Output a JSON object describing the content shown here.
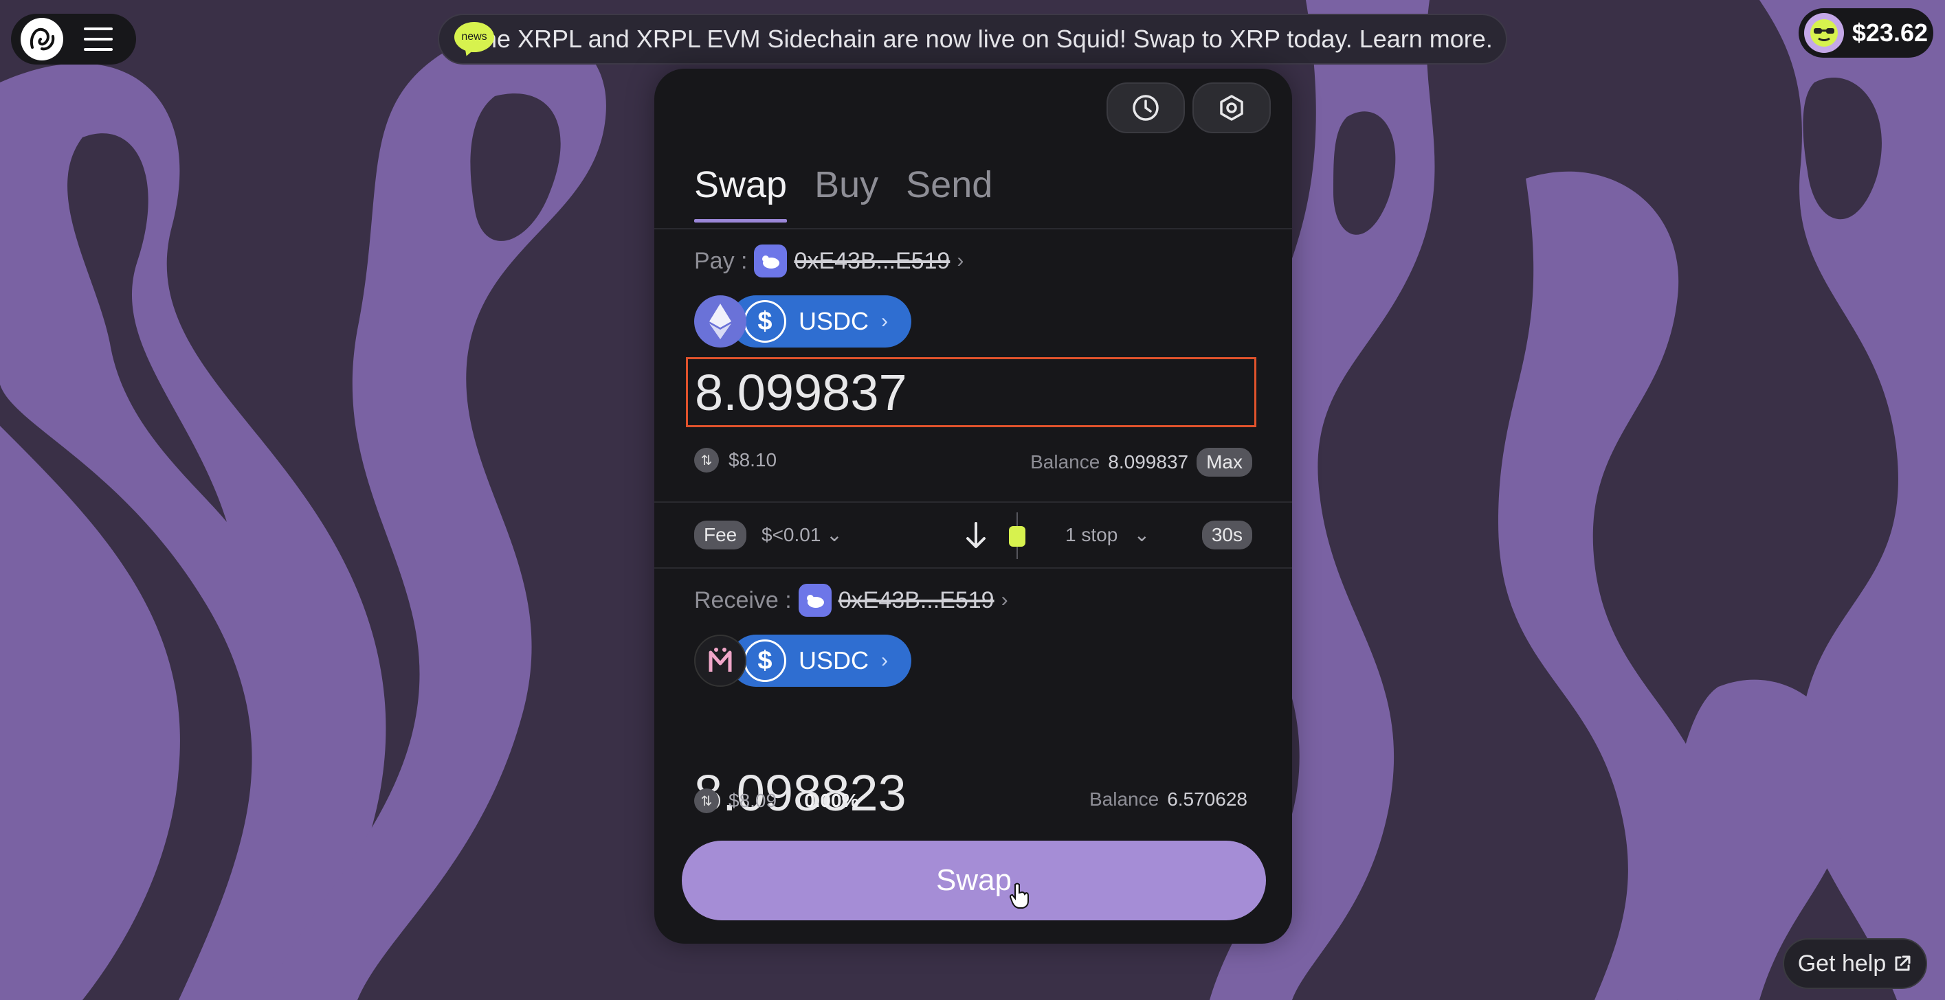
{
  "banner": {
    "badge": "news",
    "text": "The XRPL and XRPL EVM Sidechain are now live on Squid! Swap to XRP today. Learn more.",
    "link_icon": "external-link-icon"
  },
  "wallet": {
    "balance": "$23.62",
    "avatar_icon": "sunglasses-face-icon"
  },
  "tabs": [
    "Swap",
    "Buy",
    "Send"
  ],
  "active_tab": "Swap",
  "pay": {
    "label": "Pay :",
    "address": "0xE43B...E519",
    "chain_icon": "ethereum-icon",
    "token": "USDC",
    "amount": "8.099837",
    "usd_value": "$8.10",
    "balance_label": "Balance",
    "balance": "8.099837",
    "max_label": "Max"
  },
  "route": {
    "fee_label": "Fee",
    "fee_value": "$<0.01",
    "stops": "1 stop",
    "time": "30s"
  },
  "receive": {
    "label": "Receive :",
    "address": "0xE43B...E519",
    "chain_icon": "mantle-icon",
    "token": "USDC",
    "amount": "8.098823",
    "usd_value": "$8.09",
    "price_impact": "0.00%",
    "balance_label": "Balance",
    "balance": "6.570628"
  },
  "actions": {
    "swap_label": "Swap",
    "help_label": "Get help"
  },
  "colors": {
    "background": "#3a3047",
    "blob": "#7a62a3",
    "card": "#17171a",
    "accent": "#a58dd6",
    "token_pill": "#2f6ed1",
    "focus_border": "#e0522c"
  }
}
